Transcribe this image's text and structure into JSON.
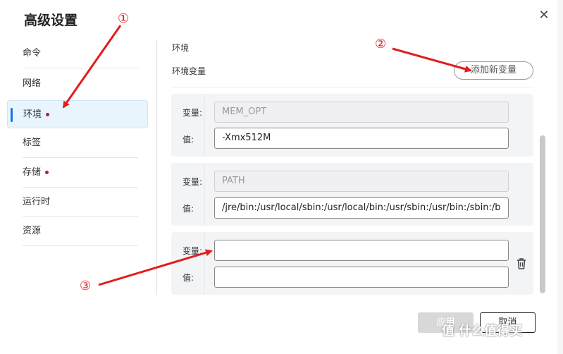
{
  "dialog": {
    "title": "高级设置"
  },
  "sidebar": {
    "items": [
      {
        "label": "命令",
        "dot": false,
        "active": false
      },
      {
        "label": "网络",
        "dot": false,
        "active": false
      },
      {
        "label": "环境",
        "dot": true,
        "active": true
      },
      {
        "label": "标签",
        "dot": false,
        "active": false
      },
      {
        "label": "存储",
        "dot": true,
        "active": false
      },
      {
        "label": "运行时",
        "dot": false,
        "active": false
      },
      {
        "label": "资源",
        "dot": false,
        "active": false
      }
    ]
  },
  "main": {
    "section_title": "环境",
    "subsection_title": "环境变量",
    "add_button": "添加新变量",
    "var_label": "变量:",
    "value_label": "值:",
    "env_vars": [
      {
        "name": "MEM_OPT",
        "value": "-Xmx512M"
      },
      {
        "name": "PATH",
        "value": "/jre/bin:/usr/local/sbin:/usr/local/bin:/usr/sbin:/usr/bin:/sbin:/b"
      },
      {
        "name": "",
        "value": ""
      }
    ]
  },
  "footer": {
    "apply": "应用",
    "cancel": "取消"
  },
  "annotations": [
    "①",
    "②",
    "③"
  ],
  "watermark": "值 什么值得买",
  "colors": {
    "accent": "#1a73e8",
    "marker_red": "#e21d1d",
    "dot_red": "#c0143c"
  }
}
